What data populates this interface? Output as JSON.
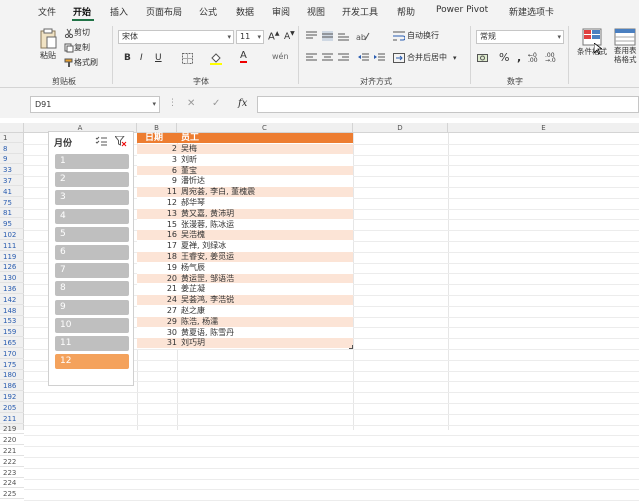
{
  "menu": {
    "items": [
      "文件",
      "开始",
      "插入",
      "页面布局",
      "公式",
      "数据",
      "审阅",
      "视图",
      "开发工具",
      "帮助",
      "Power Pivot",
      "新建选项卡"
    ],
    "active_index": 1
  },
  "clipboard": {
    "paste": "粘贴",
    "cut": "剪切",
    "copy": "复制",
    "format_painter": "格式刷",
    "label": "剪贴板"
  },
  "font": {
    "name": "宋体",
    "size": "11",
    "label": "字体",
    "bold": "B",
    "italic": "I",
    "underline": "U"
  },
  "alignment": {
    "wrap": "自动换行",
    "merge": "合并后居中",
    "label": "对齐方式"
  },
  "number": {
    "format": "常规",
    "percent": "%",
    "label": "数字"
  },
  "styles": {
    "conditional": "条件格式",
    "table": "套用表格格式"
  },
  "formula_bar": {
    "name_box": "D91",
    "fx": "fx",
    "value": ""
  },
  "columns": [
    "A",
    "B",
    "C",
    "D",
    "E"
  ],
  "rows": [
    "1",
    "8",
    "9",
    "33",
    "37",
    "41",
    "75",
    "81",
    "95",
    "102",
    "111",
    "119",
    "126",
    "130",
    "136",
    "142",
    "148",
    "153",
    "159",
    "165",
    "170",
    "175",
    "180",
    "186",
    "192",
    "205",
    "211",
    "219",
    "220",
    "221",
    "222",
    "223",
    "224",
    "225"
  ],
  "table": {
    "headers": {
      "day": "日期",
      "staff": "员工"
    },
    "rows": [
      {
        "day": "2",
        "staff": "吴梅"
      },
      {
        "day": "3",
        "staff": "刘昕"
      },
      {
        "day": "6",
        "staff": "董宝"
      },
      {
        "day": "9",
        "staff": "潘忻达"
      },
      {
        "day": "11",
        "staff": "周宛荟, 李白, 董槐震"
      },
      {
        "day": "12",
        "staff": "郝华琴"
      },
      {
        "day": "13",
        "staff": "黄又嘉, 黄沛玥"
      },
      {
        "day": "15",
        "staff": "张漫蓉, 陈冰运"
      },
      {
        "day": "16",
        "staff": "吴浩槐"
      },
      {
        "day": "17",
        "staff": "夏禅, 刘绿冰"
      },
      {
        "day": "18",
        "staff": "王睿安, 姜觅运"
      },
      {
        "day": "19",
        "staff": "杨气辰"
      },
      {
        "day": "20",
        "staff": "黄运罡, 邹语浩"
      },
      {
        "day": "21",
        "staff": "姜芷凝"
      },
      {
        "day": "24",
        "staff": "吴荟鸿, 李浩锐"
      },
      {
        "day": "27",
        "staff": "赵之康"
      },
      {
        "day": "29",
        "staff": "陈浩, 杨濡"
      },
      {
        "day": "30",
        "staff": "黄夏语, 陈雪丹"
      },
      {
        "day": "31",
        "staff": "刘巧玥"
      }
    ]
  },
  "slicer": {
    "title": "月份",
    "items": [
      "1",
      "2",
      "3",
      "4",
      "5",
      "6",
      "7",
      "8",
      "9",
      "10",
      "11",
      "12"
    ],
    "selected": "12"
  },
  "colors": {
    "accent": "#217346",
    "table_header": "#ed7d31",
    "band": "#fce4d6",
    "slicer_selected": "#f4a25c",
    "slicer_item": "#bfbfbf"
  }
}
